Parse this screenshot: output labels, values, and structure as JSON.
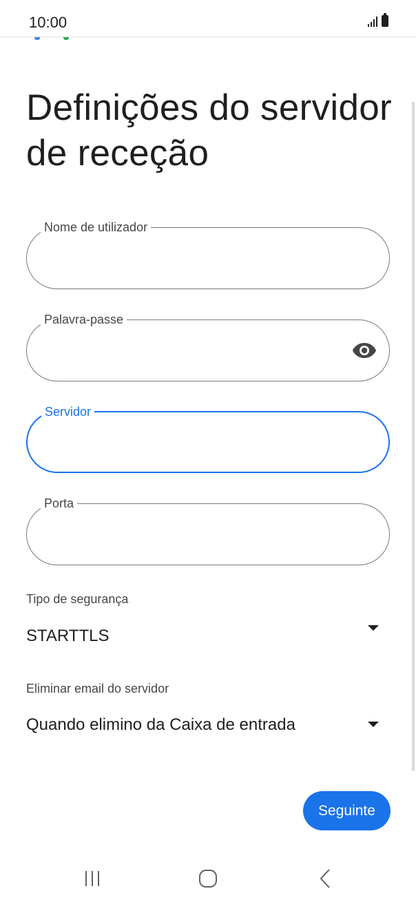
{
  "status_bar": {
    "time": "10:00"
  },
  "page": {
    "title": "Definições do servidor de receção"
  },
  "fields": [
    {
      "label": "Nome de utilizador",
      "value": ""
    },
    {
      "label": "Palavra-passe",
      "value": ""
    },
    {
      "label": "Servidor",
      "value": ""
    },
    {
      "label": "Porta",
      "value": ""
    }
  ],
  "security": {
    "label": "Tipo de segurança",
    "value": "STARTTLS"
  },
  "delete_email": {
    "label": "Eliminar email do servidor",
    "value": "Quando elimino da Caixa de entrada"
  },
  "actions": {
    "next_label": "Seguinte"
  },
  "colors": {
    "accent": "#1a73e8",
    "text": "#1f1f1f",
    "outline": "#7a7a7a"
  },
  "icons": {
    "password_toggle": "eye-icon",
    "dropdown": "caret-down-icon",
    "nav": [
      "recents-icon",
      "home-icon",
      "back-icon"
    ]
  }
}
